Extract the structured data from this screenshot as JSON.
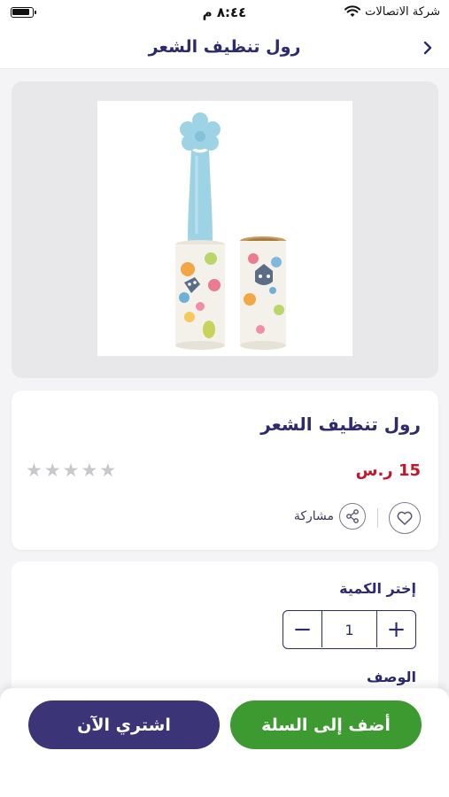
{
  "status_bar": {
    "carrier": "شركة الاتصالات",
    "time": "٨:٤٤ م"
  },
  "header": {
    "title": "رول تنظيف الشعر",
    "back_icon": "chevron-right-icon"
  },
  "product": {
    "name": "رول تنظيف الشعر",
    "price": "15 ر.س",
    "rating": {
      "value": 0,
      "max": 5
    },
    "share_label": "مشاركة",
    "icons": {
      "favorite": "heart-icon",
      "share": "share-icon"
    }
  },
  "quantity": {
    "label": "إختر الكمية",
    "value": "1",
    "decrement": "−",
    "increment": "+"
  },
  "description": {
    "label": "الوصف"
  },
  "actions": {
    "add_to_cart": "أضف إلى السلة",
    "buy_now": "اشتري الآن"
  },
  "colors": {
    "primary": "#2d2a6e",
    "price": "#c4172c",
    "cart_button": "#3d9a30",
    "buy_button": "#3b3577"
  }
}
